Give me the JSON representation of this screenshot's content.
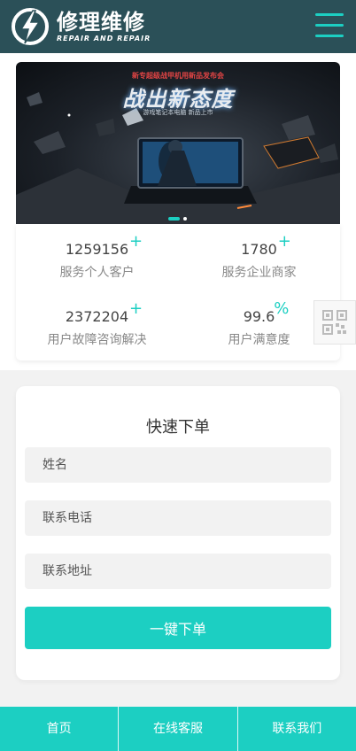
{
  "header": {
    "logo_cn": "修理维修",
    "logo_en": "REPAIR AND REPAIR",
    "menu_icon": "hamburger-menu-icon",
    "accent_color": "#1ccfc2",
    "background_color": "#2b5058"
  },
  "banner": {
    "top_text": "新专超级战甲机用新品发布会",
    "title": "战出新态度",
    "subtitle": "游戏笔记本电脑 新品上市",
    "slide_count": 2,
    "active_slide": 1
  },
  "stats": [
    {
      "value": "1259156",
      "suffix": "+",
      "label": "服务个人客户"
    },
    {
      "value": "1780",
      "suffix": "+",
      "label": "服务企业商家"
    },
    {
      "value": "2372204",
      "suffix": "+",
      "label": "用户故障咨询解决"
    },
    {
      "value": "99.6",
      "suffix": "%",
      "label": "用户满意度"
    }
  ],
  "qr_icon": "qr-code-icon",
  "order_form": {
    "title": "快速下单",
    "name_placeholder": "姓名",
    "phone_placeholder": "联系电话",
    "address_placeholder": "联系地址",
    "submit_label": "一键下单"
  },
  "bottom_nav": {
    "items": [
      {
        "label": "首页"
      },
      {
        "label": "在线客服"
      },
      {
        "label": "联系我们"
      }
    ]
  }
}
